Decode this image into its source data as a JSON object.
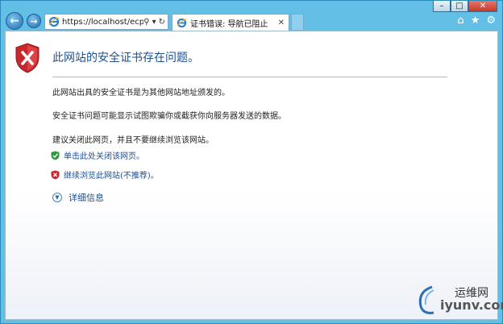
{
  "browser": {
    "address_url": "https://localhost/ecp",
    "tab_title": "证书错误: 导航已阻止",
    "window_buttons": [
      "minimize",
      "maximize",
      "close"
    ],
    "toolbar_icons": [
      "home-icon",
      "star-icon",
      "gear-icon"
    ]
  },
  "page": {
    "headline": "此网站的安全证书存在问题。",
    "para1": "此网站出具的安全证书是为其他网站地址颁发的。",
    "para2": "安全证书问题可能显示试图欺骗你或截获你向服务器发送的数据。",
    "para3": "建议关闭此网页，并且不要继续浏览该网站。",
    "link_close": "单击此处关闭该网页。",
    "link_continue": "继续浏览此网站(不推荐)。",
    "details": "详细信息"
  },
  "watermark": {
    "cn": "运维网",
    "en": "iyunv.com"
  },
  "colors": {
    "chrome": "#64bfe6",
    "headline": "#1f4f8f",
    "link": "#1a4f97",
    "error_red": "#c8282c",
    "safe_green": "#2e9a3b"
  }
}
